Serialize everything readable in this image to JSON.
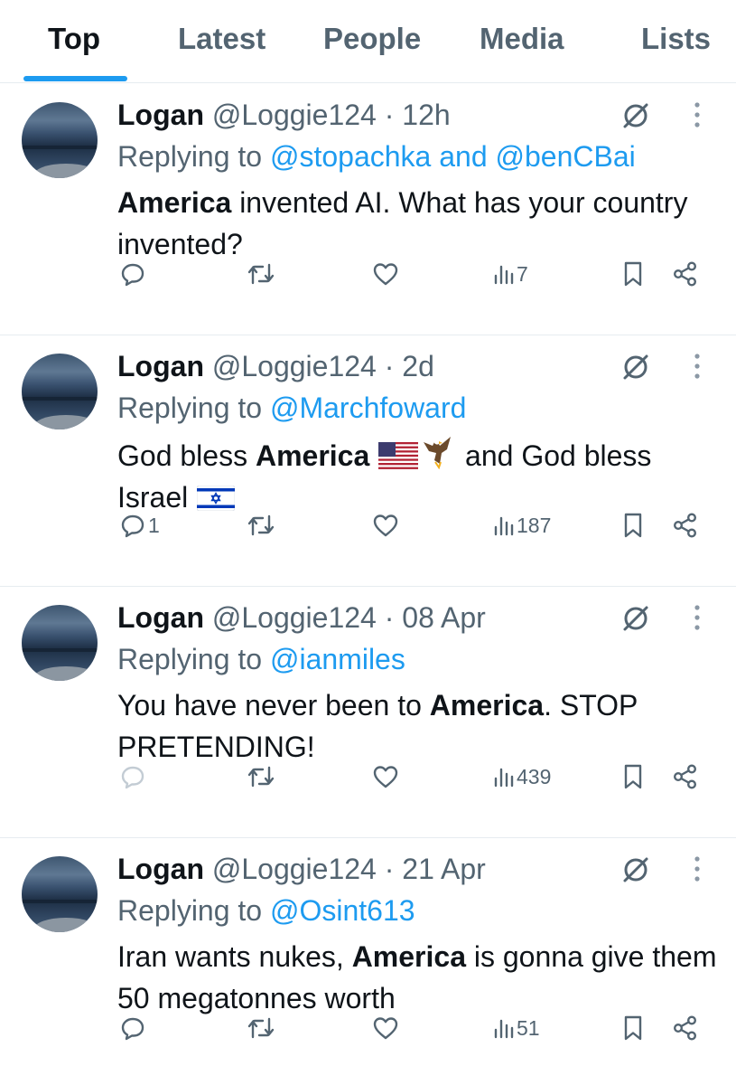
{
  "tabs": [
    {
      "label": "Top",
      "active": true
    },
    {
      "label": "Latest",
      "active": false
    },
    {
      "label": "People",
      "active": false
    },
    {
      "label": "Media",
      "active": false
    },
    {
      "label": "Lists",
      "active": false
    }
  ],
  "colors": {
    "accent": "#1d9bf0",
    "text": "#0f1419",
    "muted": "#536471",
    "divider": "#e6ecf0"
  },
  "tweets": [
    {
      "name": "Logan",
      "handle": "@Loggie124",
      "separator": "·",
      "time": "12h",
      "replying_prefix": "Replying to",
      "replying_to": "@stopachka and @benCBai",
      "text_parts": [
        {
          "t": "America",
          "bold": true
        },
        {
          "t": " invented AI. What has your country invented?",
          "bold": false
        }
      ],
      "replies": "",
      "retweets": "",
      "likes": "",
      "views": "7",
      "icons": [
        "cancel-icon",
        "more-icon",
        "reply-icon",
        "retweet-icon",
        "like-icon",
        "views-icon",
        "bookmark-icon",
        "share-icon"
      ]
    },
    {
      "name": "Logan",
      "handle": "@Loggie124",
      "separator": "·",
      "time": "2d",
      "replying_prefix": "Replying to",
      "replying_to": "@Marchfoward",
      "text_parts": [
        {
          "t": "God bless ",
          "bold": false
        },
        {
          "t": "America",
          "bold": true
        },
        {
          "t": " ",
          "bold": false
        },
        {
          "t": "[us-flag-emoji]",
          "emoji": "us-flag"
        },
        {
          "t": "[eagle-emoji]",
          "emoji": "eagle"
        },
        {
          "t": "  and God bless Israel ",
          "bold": false
        },
        {
          "t": "[israel-flag-emoji]",
          "emoji": "israel-flag"
        }
      ],
      "replies": "1",
      "retweets": "",
      "likes": "",
      "views": "187",
      "icons": [
        "cancel-icon",
        "more-icon",
        "reply-icon",
        "retweet-icon",
        "like-icon",
        "views-icon",
        "bookmark-icon",
        "share-icon"
      ]
    },
    {
      "name": "Logan",
      "handle": "@Loggie124",
      "separator": "·",
      "time": "08 Apr",
      "replying_prefix": "Replying to",
      "replying_to": "@ianmiles",
      "text_parts": [
        {
          "t": "You have never been to ",
          "bold": false
        },
        {
          "t": "America",
          "bold": true
        },
        {
          "t": ". STOP PRETENDING!",
          "bold": false
        }
      ],
      "replies": "",
      "retweets": "",
      "likes": "",
      "views": "439",
      "reply_disabled": true,
      "icons": [
        "cancel-icon",
        "more-icon",
        "reply-icon",
        "retweet-icon",
        "like-icon",
        "views-icon",
        "bookmark-icon",
        "share-icon"
      ]
    },
    {
      "name": "Logan",
      "handle": "@Loggie124",
      "separator": "·",
      "time": "21 Apr",
      "replying_prefix": "Replying to",
      "replying_to": "@Osint613",
      "text_parts": [
        {
          "t": "Iran wants nukes, ",
          "bold": false
        },
        {
          "t": "America",
          "bold": true
        },
        {
          "t": " is gonna give them 50 megatonnes worth",
          "bold": false
        }
      ],
      "replies": "",
      "retweets": "",
      "likes": "",
      "views": "51",
      "icons": [
        "cancel-icon",
        "more-icon",
        "reply-icon",
        "retweet-icon",
        "like-icon",
        "views-icon",
        "bookmark-icon",
        "share-icon"
      ]
    }
  ]
}
